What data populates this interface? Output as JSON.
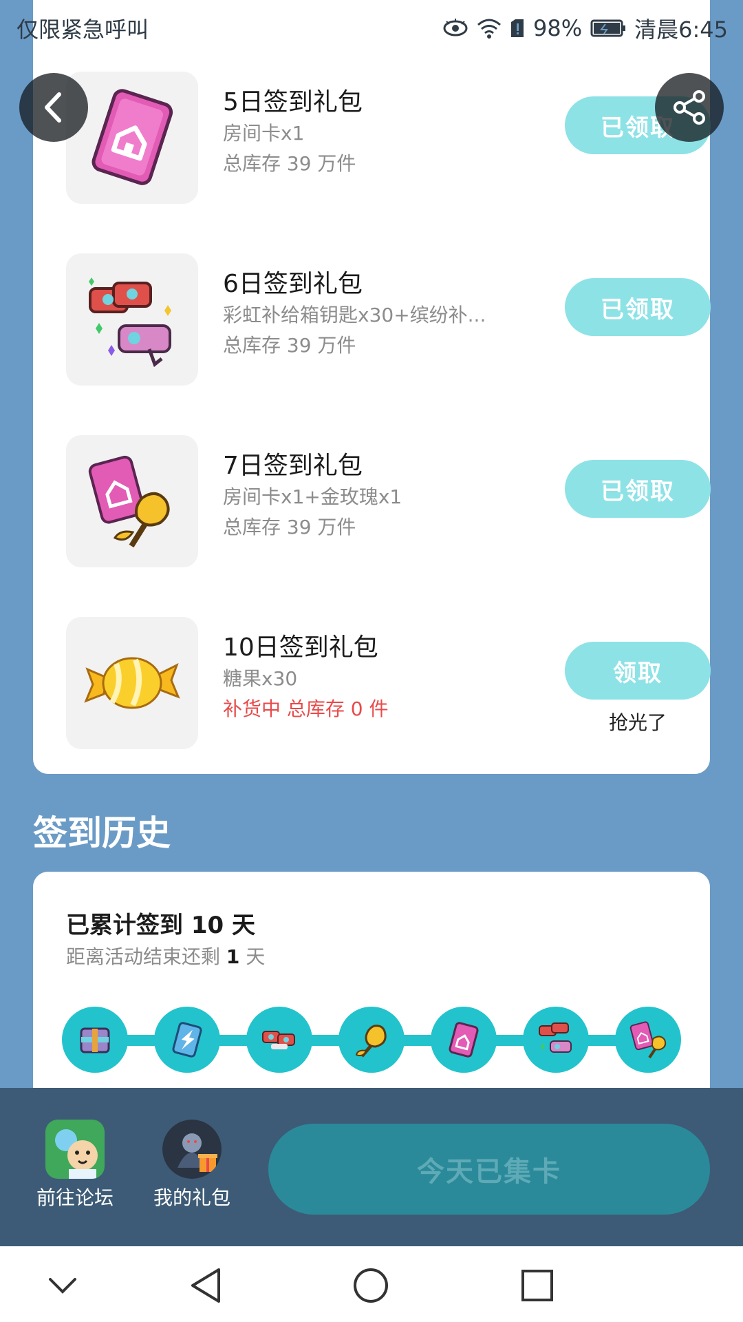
{
  "status_bar": {
    "carrier_text": "仅限紧急呼叫",
    "battery_percent": "98%",
    "time": "清晨6:45",
    "icons": [
      "eye-icon",
      "wifi-icon",
      "sim-alert-icon",
      "battery-icon"
    ]
  },
  "gifts": [
    {
      "title": "5日签到礼包",
      "desc": "房间卡x1",
      "stock": "总库存 39 万件",
      "button": "已领取",
      "icon": "room-card-icon"
    },
    {
      "title": "6日签到礼包",
      "desc": "彩虹补给箱钥匙x30+缤纷补...",
      "stock": "总库存 39 万件",
      "button": "已领取",
      "icon": "key-bundle-icon"
    },
    {
      "title": "7日签到礼包",
      "desc": "房间卡x1+金玫瑰x1",
      "stock": "总库存 39 万件",
      "button": "已领取",
      "icon": "room-card-rose-icon"
    },
    {
      "title": "10日签到礼包",
      "desc": "糖果x30",
      "stock": "补货中 总库存 0 件",
      "button": "领取",
      "note": "抢光了",
      "icon": "candy-icon"
    }
  ],
  "history": {
    "title": "签到历史",
    "total_prefix": "已累计签到",
    "total_days": "10",
    "total_suffix": "天",
    "remain_prefix": "距离活动结束还剩",
    "remain_days": "1",
    "remain_suffix": "天",
    "rewards": [
      "supply-box-icon",
      "lightning-card-icon",
      "keys-icon",
      "gold-rose-icon",
      "room-card-icon",
      "key-bundle-icon",
      "room-card-rose-icon"
    ]
  },
  "action_bar": {
    "forum_label": "前往论坛",
    "gifts_label": "我的礼包",
    "collect_label": "今天已集卡"
  },
  "colors": {
    "background": "#6a9bc6",
    "accent": "#22c3cc",
    "claimed_button": "#8de2e6",
    "alert_red": "#e84a4a",
    "action_bar": "#3d5b76"
  }
}
